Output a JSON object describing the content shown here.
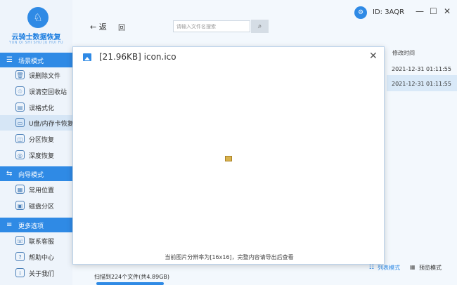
{
  "app": {
    "logo_glyph": "♘",
    "title": "云骑士数据恢复",
    "subtitle": "YUN QI SHI SHU JU HUI FU"
  },
  "sidebar": {
    "sections": [
      {
        "icon": "☰",
        "label": "场景模式"
      },
      {
        "icon": "⇆",
        "label": "向导模式"
      },
      {
        "icon": "≡",
        "label": "更多选项"
      }
    ],
    "scene_items": [
      {
        "icon": "🗑",
        "label": "误删除文件"
      },
      {
        "icon": "♲",
        "label": "误清空回收站"
      },
      {
        "icon": "▤",
        "label": "误格式化"
      },
      {
        "icon": "▭",
        "label": "U盘/内存卡恢复"
      },
      {
        "icon": "◫",
        "label": "分区恢复"
      },
      {
        "icon": "◎",
        "label": "深度恢复"
      }
    ],
    "wizard_items": [
      {
        "icon": "▦",
        "label": "常用位置"
      },
      {
        "icon": "▣",
        "label": "磁盘分区"
      }
    ],
    "more_items": [
      {
        "icon": "☏",
        "label": "联系客服"
      },
      {
        "icon": "?",
        "label": "帮助中心"
      },
      {
        "icon": "i",
        "label": "关于我们"
      }
    ]
  },
  "toolbar": {
    "back_label": "← 返",
    "home_label": "回",
    "search_placeholder": "请输入文件名搜索",
    "search_icon": "⌕"
  },
  "header": {
    "user_icon": "⚙",
    "user_id": "ID: 3AQR",
    "minimize": "—",
    "maximize": "☐",
    "close": "✕"
  },
  "file_list": {
    "column_modified": "修改时间",
    "rows": [
      {
        "modified": "2021-12-31 01:11:55"
      },
      {
        "modified": "2021-12-31 01:11:55"
      }
    ]
  },
  "views": {
    "list_label": "列表模式",
    "preview_label": "预览模式",
    "list_icon": "☷",
    "preview_icon": "▦"
  },
  "status": {
    "text": "扫描到224个文件(共4.89GB)"
  },
  "dialog": {
    "title": "[21.96KB] icon.ico",
    "close": "✕",
    "footer": "当前图片分辨率为[16x16]，完整内容请导出后查看"
  },
  "colors": {
    "accent": "#2f8ae5",
    "sidebar_bg": "#eef4fb",
    "selected_row": "#d9e9f8"
  }
}
